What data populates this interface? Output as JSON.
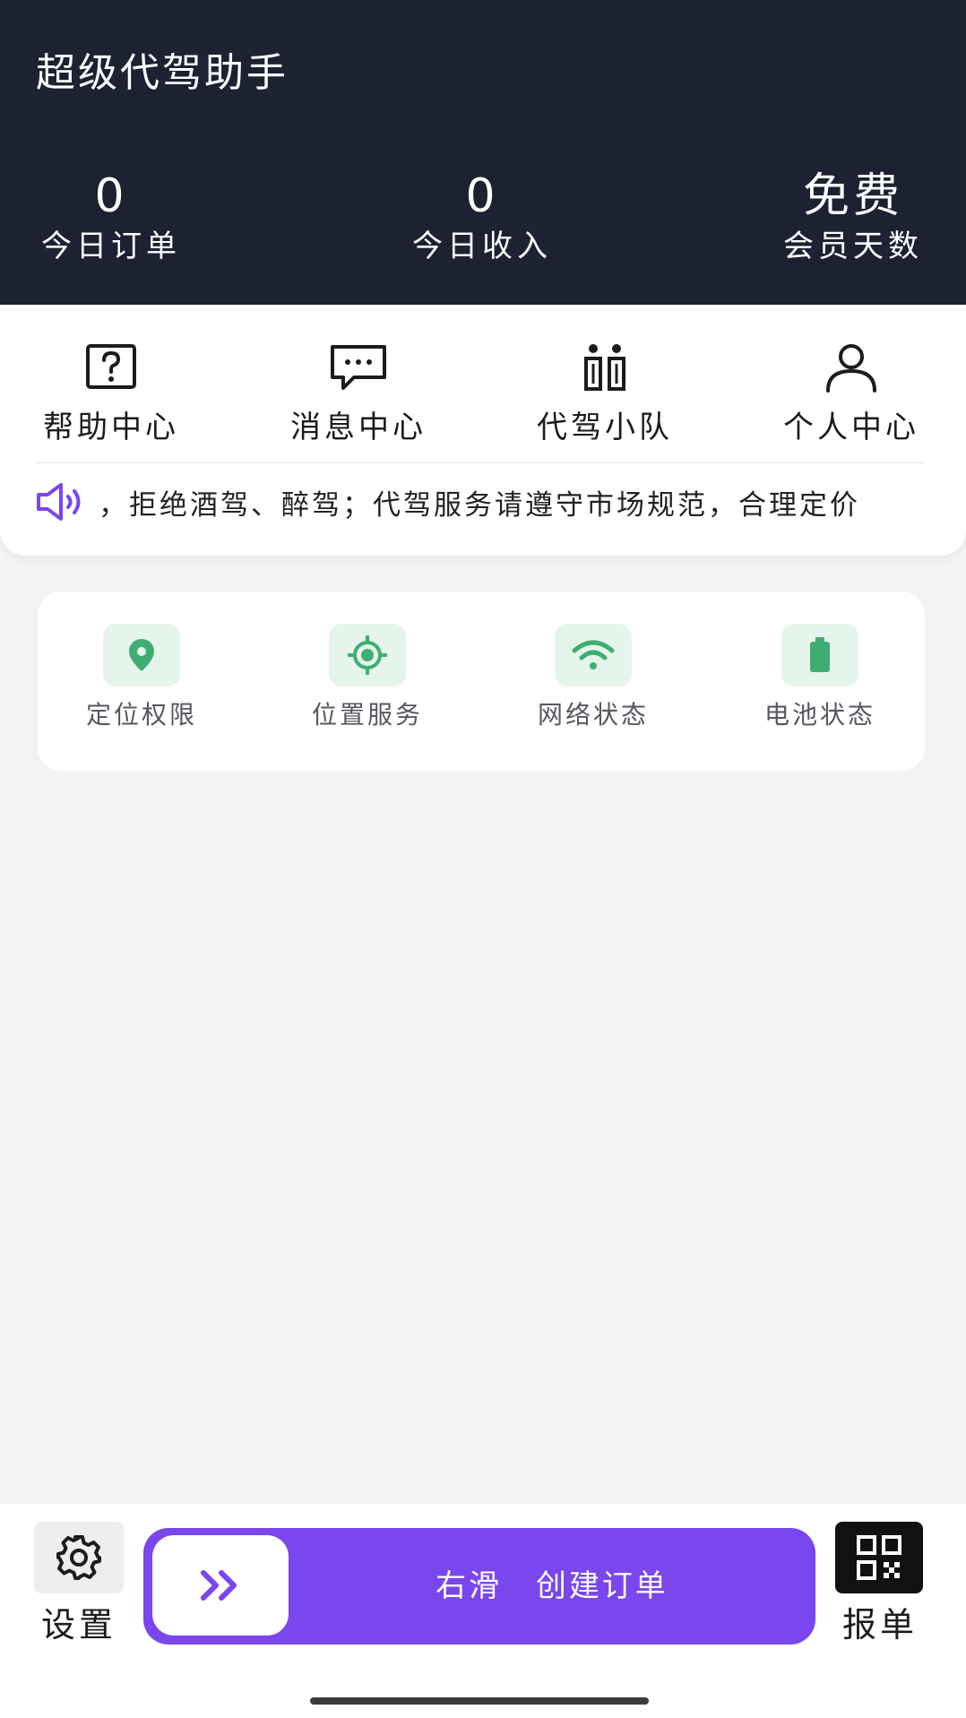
{
  "header": {
    "app_title": "超级代驾助手",
    "stats": [
      {
        "value": "0",
        "label": "今日订单"
      },
      {
        "value": "0",
        "label": "今日收入"
      },
      {
        "value": "免费",
        "label": "会员天数"
      }
    ]
  },
  "menu": {
    "items": [
      {
        "label": "帮助中心",
        "icon": "help-icon"
      },
      {
        "label": "消息中心",
        "icon": "message-icon"
      },
      {
        "label": "代驾小队",
        "icon": "team-icon"
      },
      {
        "label": "个人中心",
        "icon": "user-icon"
      }
    ]
  },
  "notice": {
    "text": "，拒绝酒驾、醉驾；代驾服务请遵守市场规范，合理定价",
    "icon": "speaker-icon"
  },
  "status": {
    "items": [
      {
        "label": "定位权限",
        "icon": "location-pin-icon"
      },
      {
        "label": "位置服务",
        "icon": "gps-target-icon"
      },
      {
        "label": "网络状态",
        "icon": "wifi-icon"
      },
      {
        "label": "电池状态",
        "icon": "battery-icon"
      }
    ]
  },
  "bottom": {
    "settings_label": "设置",
    "report_label": "报单",
    "slider_text": "右滑 创建订单"
  },
  "colors": {
    "header_bg": "#1c2232",
    "accent_purple": "#7a46ee",
    "status_green": "#3fae72",
    "status_tile_bg": "#e6f5ec"
  }
}
